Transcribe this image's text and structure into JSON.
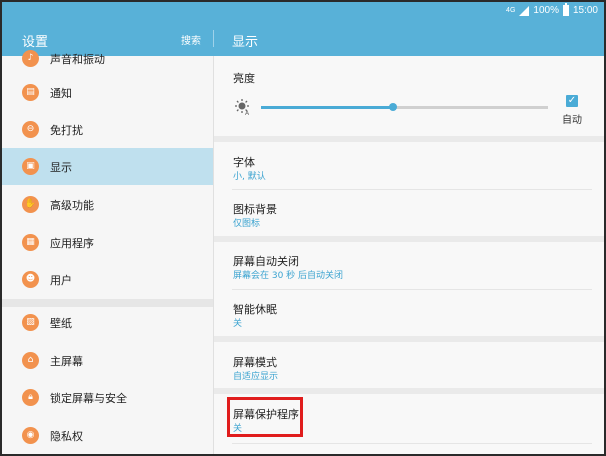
{
  "status_bar": {
    "signal": "4G",
    "battery": "100%",
    "time": "15:00"
  },
  "header": {
    "left_title": "设置",
    "search_label": "搜索",
    "right_title": "显示"
  },
  "sidebar": {
    "items": [
      {
        "label": "声音和振动",
        "icon": "volume-icon"
      },
      {
        "label": "通知",
        "icon": "notification-icon"
      },
      {
        "label": "免打扰",
        "icon": "do-not-disturb-icon"
      },
      {
        "label": "显示",
        "icon": "display-icon",
        "active": true
      },
      {
        "label": "高级功能",
        "icon": "advanced-features-icon"
      },
      {
        "label": "应用程序",
        "icon": "apps-icon"
      },
      {
        "label": "用户",
        "icon": "users-icon"
      },
      {
        "label": "壁纸",
        "icon": "wallpaper-icon"
      },
      {
        "label": "主屏幕",
        "icon": "home-icon"
      },
      {
        "label": "锁定屏幕与安全",
        "icon": "lock-icon"
      },
      {
        "label": "隐私权",
        "icon": "privacy-icon"
      }
    ]
  },
  "display": {
    "brightness": {
      "title": "亮度",
      "auto_label": "自动",
      "auto_checked": true,
      "level": 0.46
    },
    "font": {
      "title": "字体",
      "value": "小, 默认"
    },
    "icon_background": {
      "title": "图标背景",
      "value": "仅图标"
    },
    "screen_timeout": {
      "title": "屏幕自动关闭",
      "value": "屏幕会在 30 秒 后自动关闭"
    },
    "smart_stay": {
      "title": "智能休眠",
      "value": "关"
    },
    "screen_mode": {
      "title": "屏幕模式",
      "value": "自适应显示"
    },
    "screensaver": {
      "title": "屏幕保护程序",
      "value": "关"
    }
  },
  "colors": {
    "accent": "#58b1d8",
    "highlight": "#e01c1c",
    "icon_orange": "#f2924e"
  }
}
